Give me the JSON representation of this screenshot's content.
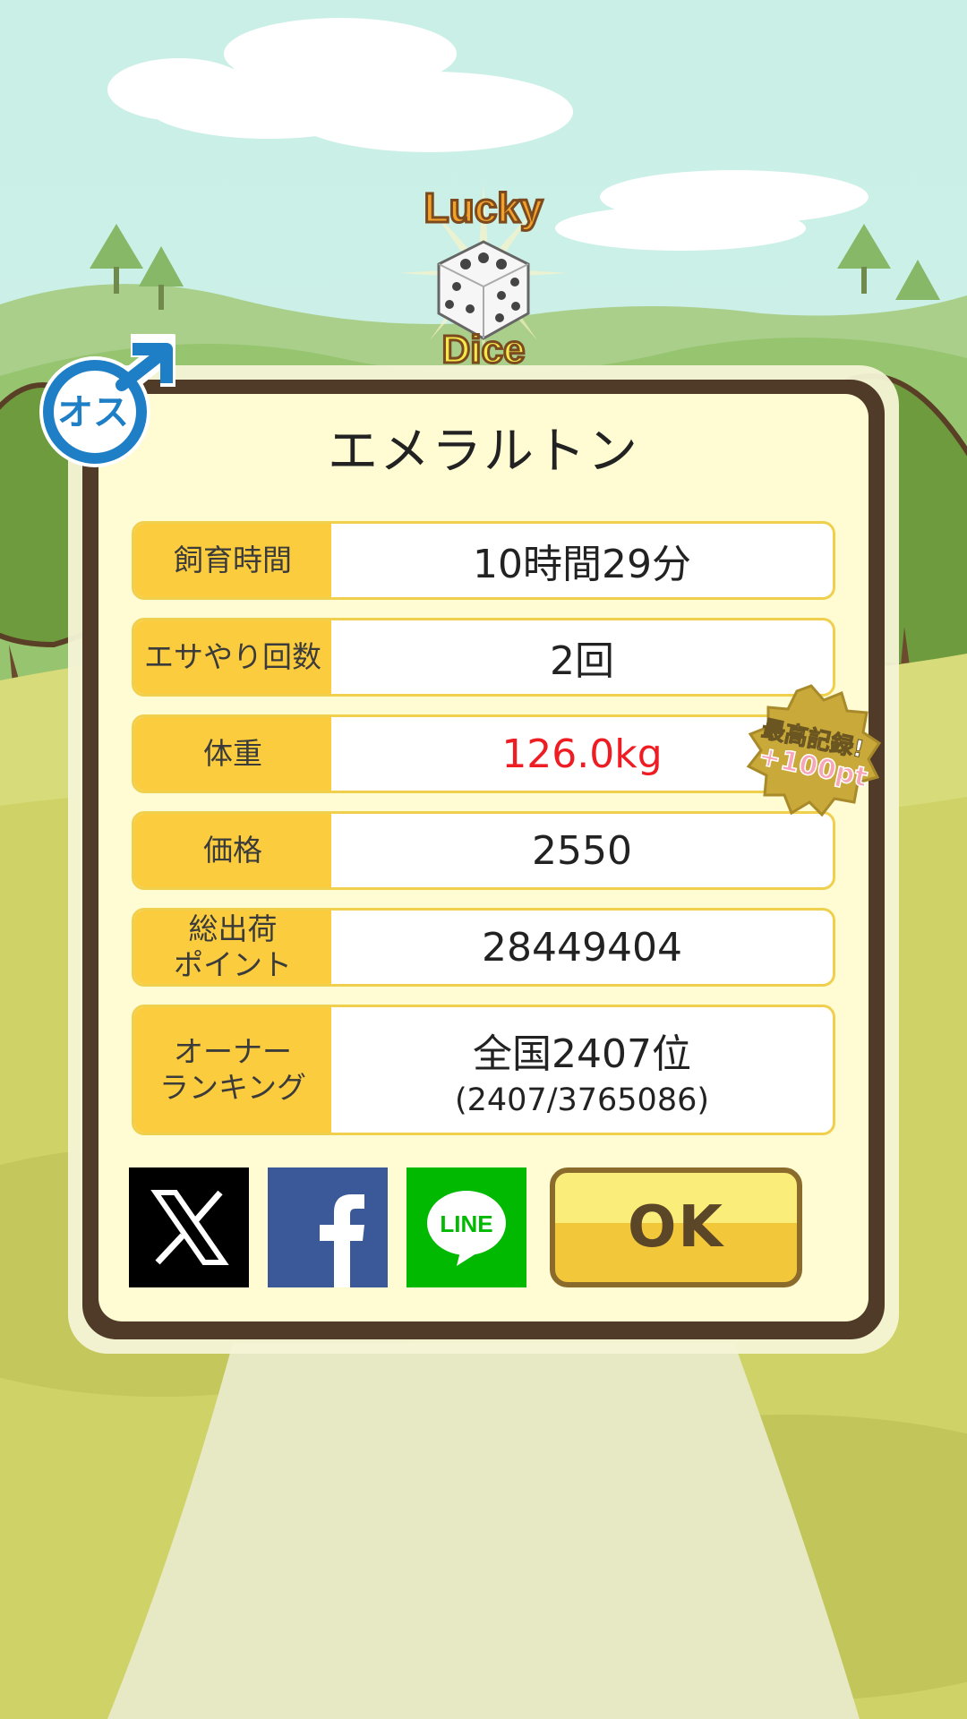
{
  "dialog": {
    "title": "エメラルトン",
    "rows": [
      {
        "label": "飼育時間",
        "value": "10時間29分"
      },
      {
        "label": "エサやり回数",
        "value": "2回"
      },
      {
        "label": "体重",
        "value": "126.0kg"
      },
      {
        "label": "価格",
        "value": "2550"
      },
      {
        "label": "総出荷\nポイント",
        "value": "28449404"
      },
      {
        "label": "オーナー\nランキング",
        "value": "全国2407位",
        "sub_value": "(2407/3765086)"
      }
    ],
    "record_badge": {
      "line1": "最高記録!",
      "line2": "+100pt"
    },
    "ok_label": "OK"
  },
  "gender_badge": {
    "label": "オス",
    "icon": "male-icon"
  },
  "logo": {
    "line1": "Lucky",
    "line2": "Dice"
  },
  "share": {
    "x": {
      "icon": "x-icon"
    },
    "facebook": {
      "icon": "facebook-icon"
    },
    "line": {
      "label": "LINE",
      "icon": "line-icon"
    }
  },
  "colors": {
    "sky": "#c8efe6",
    "grass": "#cdd25a",
    "panel_border": "#4f3b27",
    "panel_bg": "#fffcd4",
    "label_bg": "#fbcd3e",
    "record_value": "#ee1d23",
    "ok_button": "#f2c83a"
  }
}
